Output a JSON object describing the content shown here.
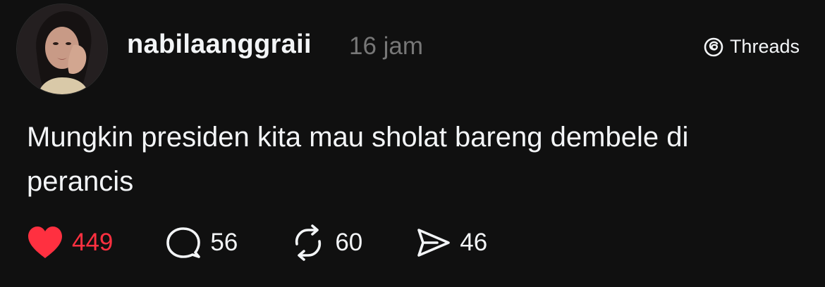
{
  "post": {
    "author": {
      "username": "nabilaanggraii",
      "avatar_icon": "profile-photo"
    },
    "timestamp": "16 jam",
    "source": {
      "label": "Threads",
      "icon": "threads-logo-icon"
    },
    "text": "Mungkin presiden kita mau sholat bareng dembele di perancis",
    "actions": {
      "like": {
        "count": "449",
        "icon": "heart-icon",
        "color": "#ff3040"
      },
      "reply": {
        "count": "56",
        "icon": "speech-bubble-icon"
      },
      "repost": {
        "count": "60",
        "icon": "repost-icon"
      },
      "share": {
        "count": "46",
        "icon": "send-icon"
      }
    }
  },
  "theme": {
    "background": "#101010",
    "text": "#f3f5f7",
    "muted": "#777777",
    "like_color": "#ff3040"
  }
}
